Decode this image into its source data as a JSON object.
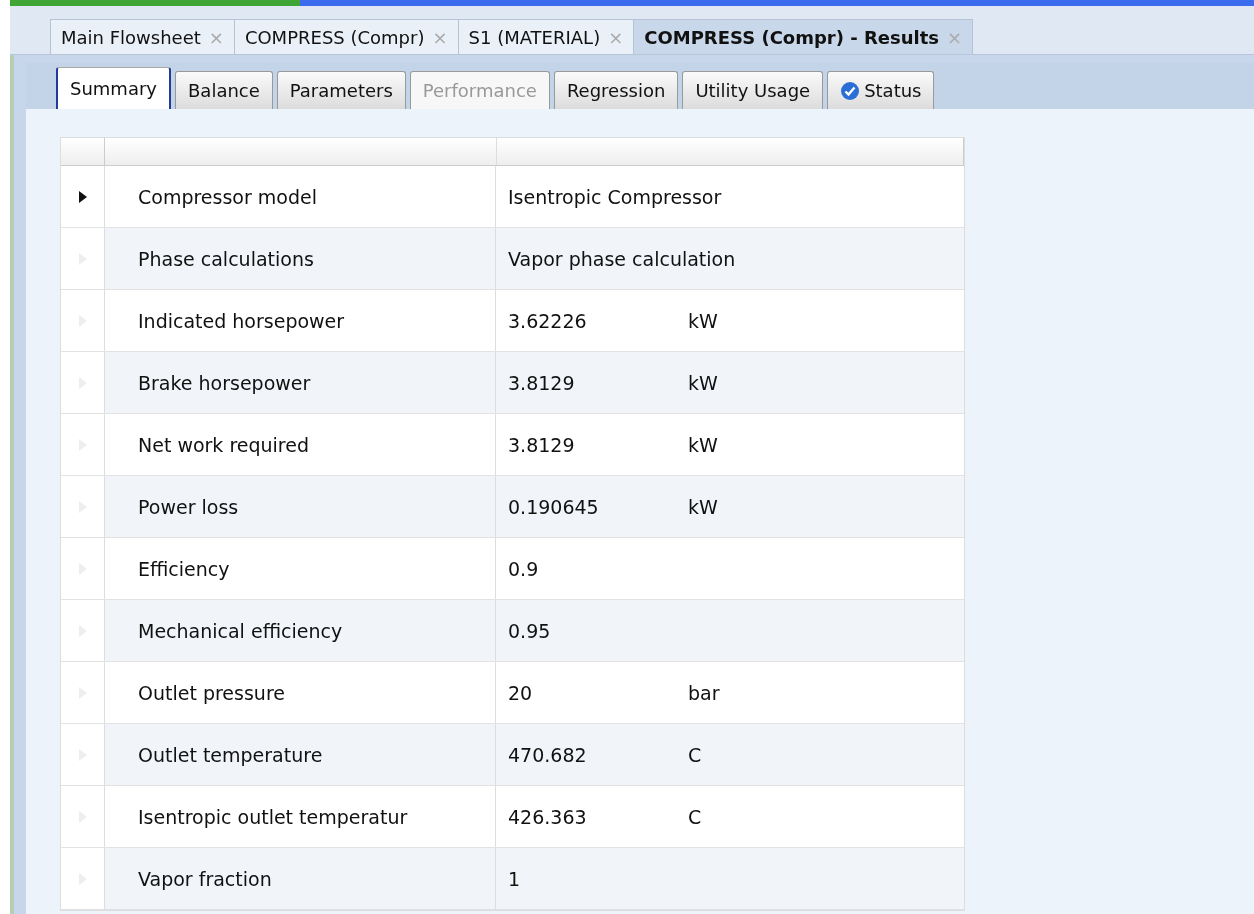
{
  "document_tabs": [
    {
      "label": "Main Flowsheet",
      "close": "×",
      "selected": false
    },
    {
      "label": "COMPRESS (Compr)",
      "close": "×",
      "selected": false
    },
    {
      "label": "S1 (MATERIAL)",
      "close": "×",
      "selected": false
    },
    {
      "label": "COMPRESS (Compr) - Results",
      "close": "×",
      "selected": true
    }
  ],
  "tabs": [
    {
      "label": "Summary",
      "selected": true,
      "disabled": false,
      "kind": "plain"
    },
    {
      "label": "Balance",
      "selected": false,
      "disabled": false,
      "kind": "plain"
    },
    {
      "label": "Parameters",
      "selected": false,
      "disabled": false,
      "kind": "plain"
    },
    {
      "label": "Performance",
      "selected": false,
      "disabled": true,
      "kind": "plain"
    },
    {
      "label": "Regression",
      "selected": false,
      "disabled": false,
      "kind": "plain"
    },
    {
      "label": "Utility Usage",
      "selected": false,
      "disabled": false,
      "kind": "plain"
    },
    {
      "label": "Status",
      "selected": false,
      "disabled": false,
      "kind": "status"
    }
  ],
  "table": {
    "rows": [
      {
        "name": "Compressor model",
        "value": "Isentropic Compressor",
        "current": true
      },
      {
        "name": "Phase calculations",
        "value": "Vapor phase calculation",
        "current": false
      },
      {
        "name": "Indicated horsepower",
        "value": "3.62226",
        "unit": "kW",
        "current": false
      },
      {
        "name": "Brake horsepower",
        "value": "3.8129",
        "unit": "kW",
        "current": false
      },
      {
        "name": "Net work required",
        "value": "3.8129",
        "unit": "kW",
        "current": false
      },
      {
        "name": "Power loss",
        "value": "0.190645",
        "unit": "kW",
        "current": false
      },
      {
        "name": "Efficiency",
        "value": "0.9",
        "current": false
      },
      {
        "name": "Mechanical efficiency",
        "value": "0.95",
        "current": false
      },
      {
        "name": "Outlet pressure",
        "value": "20",
        "unit": "bar",
        "current": false
      },
      {
        "name": "Outlet temperature",
        "value": "470.682",
        "unit": "C",
        "current": false
      },
      {
        "name": "Isentropic outlet temperatur",
        "value": "426.363",
        "unit": "C",
        "current": false
      },
      {
        "name": "Vapor fraction",
        "value": "1",
        "current": false
      }
    ]
  }
}
